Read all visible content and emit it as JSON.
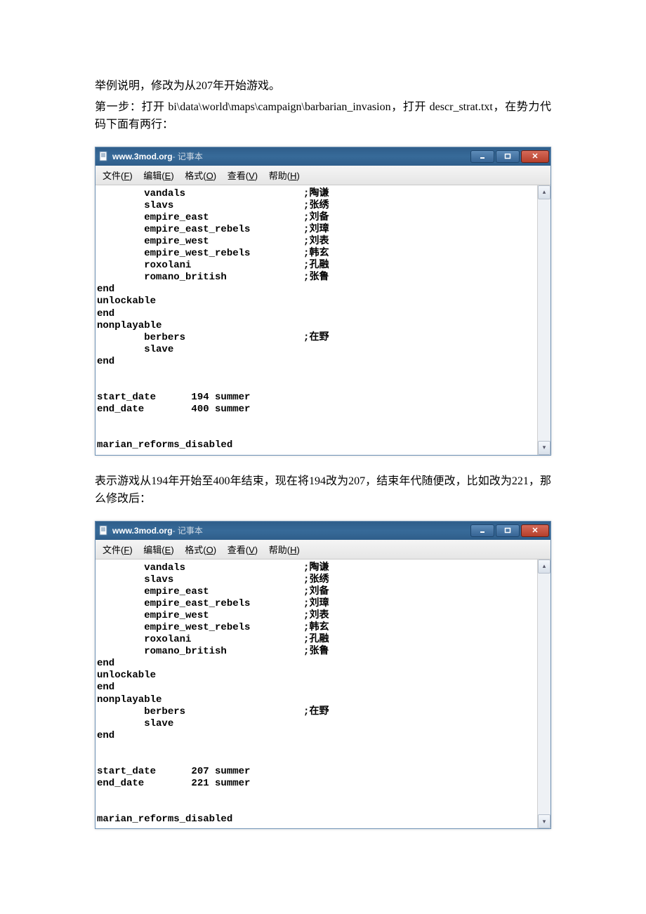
{
  "intro": {
    "line1": "举例说明，修改为从207年开始游戏。",
    "line2": "第一步：打开 bi\\data\\world\\maps\\campaign\\barbarian_invasion，打开 descr_strat.txt，在势力代码下面有两行："
  },
  "middle": {
    "line": "表示游戏从194年开始至400年结束，现在将194改为207，结束年代随便改，比如改为221，那么修改后："
  },
  "notepad": {
    "title": "www.3mod.org",
    "sub": " - 记事本",
    "menus": {
      "file": {
        "label": "文件",
        "accel": "F"
      },
      "edit": {
        "label": "编辑",
        "accel": "E"
      },
      "format": {
        "label": "格式",
        "accel": "O"
      },
      "view": {
        "label": "查看",
        "accel": "V"
      },
      "help": {
        "label": "帮助",
        "accel": "H"
      }
    }
  },
  "code1": "        vandals                    ;陶谦\n        slavs                      ;张绣\n        empire_east                ;刘备\n        empire_east_rebels         ;刘璋\n        empire_west                ;刘表\n        empire_west_rebels         ;韩玄\n        roxolani                   ;孔融\n        romano_british             ;张鲁\nend\nunlockable\nend\nnonplayable\n        berbers                    ;在野\n        slave\nend\n\n\nstart_date      194 summer\nend_date        400 summer\n\n\nmarian_reforms_disabled",
  "code2": "        vandals                    ;陶谦\n        slavs                      ;张绣\n        empire_east                ;刘备\n        empire_east_rebels         ;刘璋\n        empire_west                ;刘表\n        empire_west_rebels         ;韩玄\n        roxolani                   ;孔融\n        romano_british             ;张鲁\nend\nunlockable\nend\nnonplayable\n        berbers                    ;在野\n        slave\nend\n\n\nstart_date      207 summer\nend_date        221 summer\n\n\nmarian_reforms_disabled"
}
